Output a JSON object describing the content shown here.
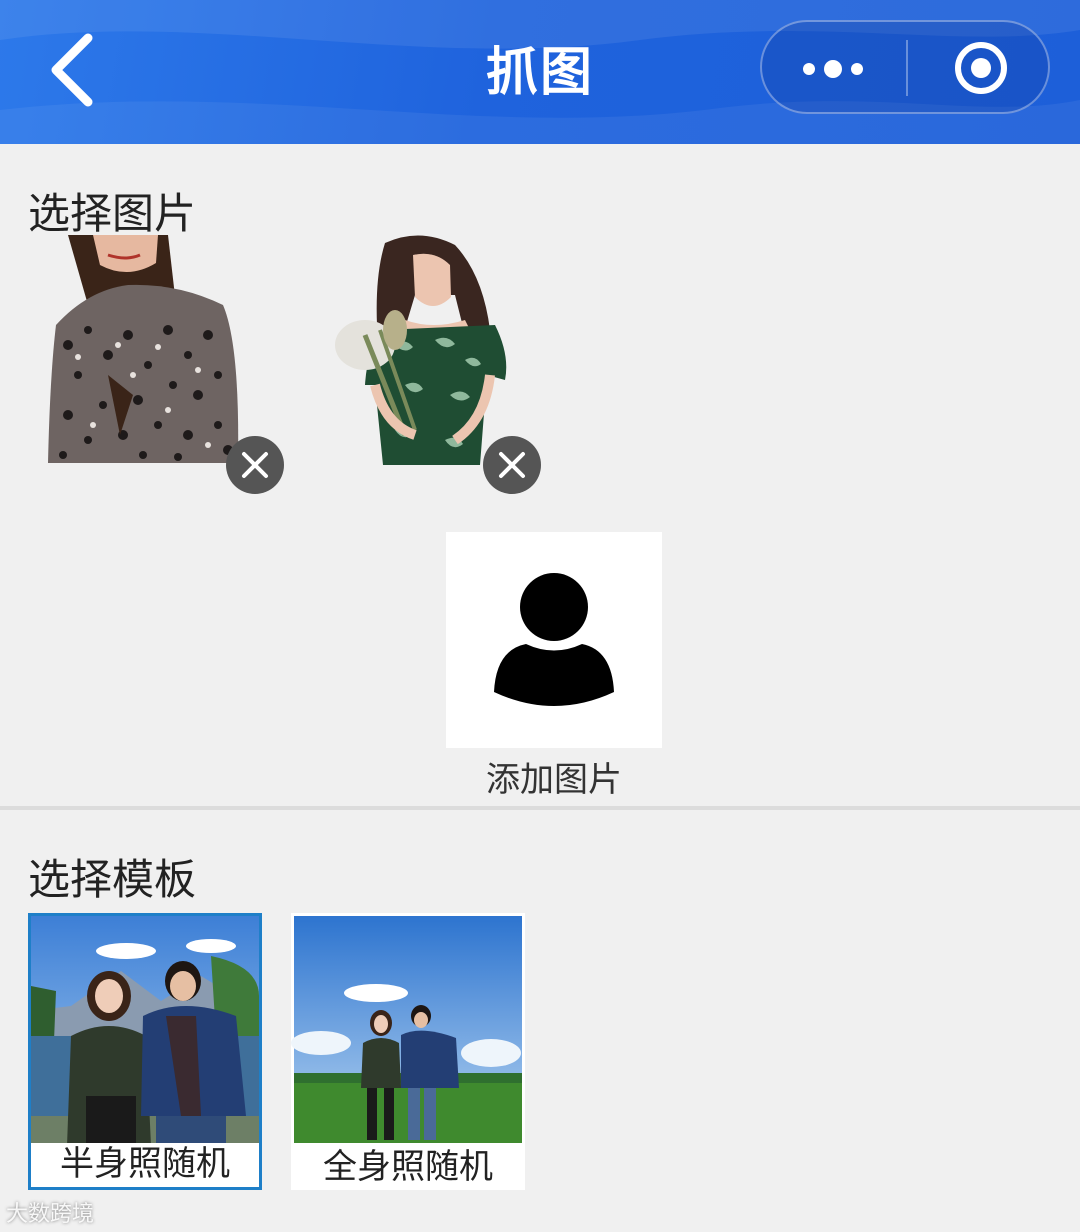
{
  "header": {
    "title": "抓图",
    "back_icon": "chevron-left-icon",
    "more_icon": "more-dots-icon",
    "close_icon": "target-circle-icon",
    "background_color": "#1f63dd"
  },
  "select_images": {
    "title": "选择图片",
    "images": [
      {
        "name": "model-photo-leopard-blouse",
        "remove_icon": "close-icon"
      },
      {
        "name": "model-photo-green-dress",
        "remove_icon": "close-icon"
      }
    ],
    "add_button": {
      "label": "添加图片",
      "icon": "user-silhouette-icon"
    }
  },
  "select_template": {
    "title": "选择模板",
    "templates": [
      {
        "label": "半身照随机",
        "selected": true
      },
      {
        "label": "全身照随机",
        "selected": false
      }
    ],
    "selected_border_color": "#1e7fc8"
  },
  "watermark": "大数跨境"
}
